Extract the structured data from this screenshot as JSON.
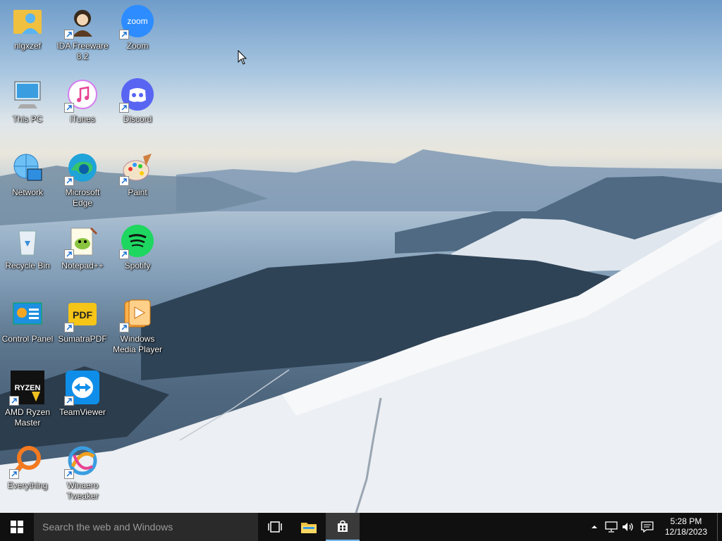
{
  "desktop": {
    "icons": [
      {
        "name": "nlgxzef",
        "icon": "user-folder-icon",
        "shortcut": false
      },
      {
        "name": "IDA Freeware 8.2",
        "icon": "ida-freeware-icon",
        "shortcut": true
      },
      {
        "name": "Zoom",
        "icon": "zoom-icon",
        "shortcut": true
      },
      {
        "name": "This PC",
        "icon": "this-pc-icon",
        "shortcut": false
      },
      {
        "name": "iTunes",
        "icon": "itunes-icon",
        "shortcut": true
      },
      {
        "name": "Discord",
        "icon": "discord-icon",
        "shortcut": true
      },
      {
        "name": "Network",
        "icon": "network-icon",
        "shortcut": false
      },
      {
        "name": "Microsoft Edge",
        "icon": "edge-icon",
        "shortcut": true
      },
      {
        "name": "Paint",
        "icon": "paint-icon",
        "shortcut": true
      },
      {
        "name": "Recycle Bin",
        "icon": "recycle-bin-icon",
        "shortcut": false
      },
      {
        "name": "Notepad++",
        "icon": "notepad-plus-plus-icon",
        "shortcut": true
      },
      {
        "name": "Spotify",
        "icon": "spotify-icon",
        "shortcut": true
      },
      {
        "name": "Control Panel",
        "icon": "control-panel-icon",
        "shortcut": false
      },
      {
        "name": "SumatraPDF",
        "icon": "sumatrapdf-icon",
        "shortcut": true
      },
      {
        "name": "Windows Media Player",
        "icon": "windows-media-player-icon",
        "shortcut": true
      },
      {
        "name": "AMD Ryzen Master",
        "icon": "amd-ryzen-master-icon",
        "shortcut": true
      },
      {
        "name": "TeamViewer",
        "icon": "teamviewer-icon",
        "shortcut": true
      },
      {
        "name": "Everything",
        "icon": "everything-icon",
        "shortcut": true
      },
      {
        "name": "Winaero Tweaker",
        "icon": "winaero-tweaker-icon",
        "shortcut": true
      }
    ]
  },
  "taskbar": {
    "search_placeholder": "Search the web and Windows",
    "pinned": [
      {
        "icon": "task-view-icon",
        "active": false
      },
      {
        "icon": "file-explorer-icon",
        "active": false
      },
      {
        "icon": "store-icon",
        "active": true
      }
    ],
    "tray": {
      "icons": [
        "chevron-up-icon",
        "network-icon",
        "volume-icon"
      ],
      "time": "5:28 PM",
      "date": "12/18/2023",
      "action_center_icon": "action-center-icon"
    }
  },
  "colors": {
    "taskbar_bg": "#101010",
    "search_bg": "#2a2a2a",
    "accent": "#76b9ed"
  }
}
